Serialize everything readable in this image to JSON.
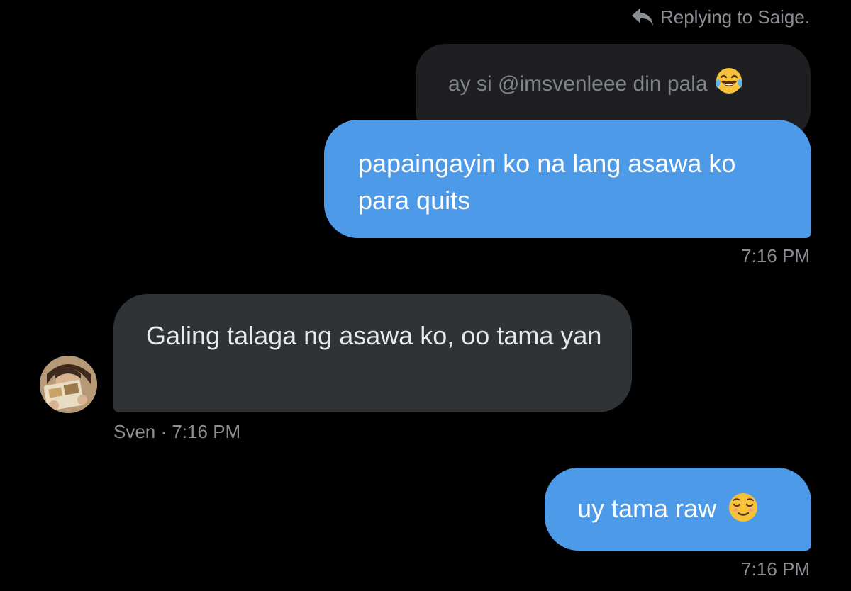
{
  "reply_header": {
    "icon": "reply-arrow-icon",
    "text": "Replying to Saige."
  },
  "quoted_message": {
    "text": "ay si @imsvenleee din pala",
    "emoji": "face-with-tears-of-joy-icon"
  },
  "messages": [
    {
      "direction": "sent",
      "text": "papaingayin ko na lang asawa ko para quits",
      "time": "7:16 PM"
    },
    {
      "direction": "received",
      "sender": "Sven",
      "text": "Galing talaga ng asawa ko, oo tama yan",
      "meta": "Sven · 7:16 PM",
      "avatar": "avatar"
    },
    {
      "direction": "sent",
      "text": "uy tama raw",
      "emoji": "relieved-face-icon",
      "time": "7:16 PM"
    }
  ],
  "colors": {
    "background": "#000000",
    "sent_bubble": "#4c9ae8",
    "received_bubble": "#2f3336",
    "quoted_bubble": "#1f1f21",
    "muted_text": "#8b8f94"
  }
}
